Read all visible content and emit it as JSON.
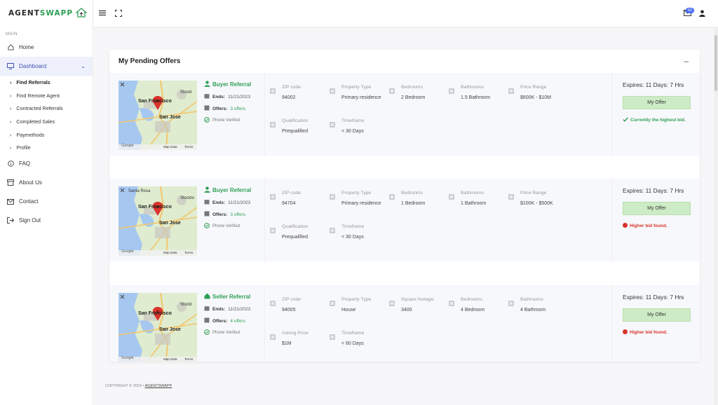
{
  "brand": {
    "logo_text_part1": "AGENT",
    "logo_text_part2": "SWAPP",
    "brand_color": "#2e9f55"
  },
  "sidebar": {
    "section_label": "MAIN",
    "home": "Home",
    "dashboard": "Dashboard",
    "sub_items": [
      {
        "label": "Find Referrals"
      },
      {
        "label": "Find Remote Agent"
      },
      {
        "label": "Contracted Referrals"
      },
      {
        "label": "Completed Sales"
      },
      {
        "label": "Paymethods"
      },
      {
        "label": "Profile"
      }
    ],
    "faq": "FAQ",
    "about": "About Us",
    "contact": "Contact",
    "signout": "Sign Out"
  },
  "topbar": {
    "mail_badge": "62"
  },
  "main": {
    "title": "My Pending Offers",
    "collapse_symbol": "–",
    "offers": [
      {
        "map_labels": {
          "city1": "San Francisco",
          "city2": "San Jose",
          "city3": "Stockt",
          "extra": ""
        },
        "ref_title": "Buyer Referral",
        "ends_label": "Ends:",
        "ends_value": "11/21/2023",
        "offers_label": "Offers:",
        "offers_value": "3 offers",
        "phone": "Phone Verified",
        "fields": [
          {
            "label": "ZIP code",
            "value": "94002"
          },
          {
            "label": "Property Type",
            "value": "Primary residence"
          },
          {
            "label": "Bedrooms",
            "value": "2 Bedroom"
          },
          {
            "label": "Bathrooms",
            "value": "1.5 Bathroom"
          },
          {
            "label": "Price Range",
            "value": "$600K - $10M"
          },
          {
            "label": "Qualification",
            "value": "Prequalified"
          },
          {
            "label": "Timeframe",
            "value": "< 30 Days"
          }
        ],
        "expires": "Expires: 11 Days: 7 Hrs",
        "button": "My Offer",
        "status": "Currently the highest bid."
      },
      {
        "map_labels": {
          "city1": "San Francisco",
          "city2": "San Jose",
          "city3": "Stockto",
          "extra": "Santa Rosa"
        },
        "ref_title": "Buyer Referral",
        "ends_label": "Ends:",
        "ends_value": "11/21/2023",
        "offers_label": "Offers:",
        "offers_value": "3 offers",
        "phone": "Phone Verified",
        "fields": [
          {
            "label": "ZIP code",
            "value": "94704"
          },
          {
            "label": "Property Type",
            "value": "Primary residence"
          },
          {
            "label": "Bedrooms",
            "value": "1 Bedroom"
          },
          {
            "label": "Bathrooms",
            "value": "1 Bathroom"
          },
          {
            "label": "Price Range",
            "value": "$100K - $500K"
          },
          {
            "label": "Qualification",
            "value": "Prequalified"
          },
          {
            "label": "Timeframe",
            "value": "< 30 Days"
          }
        ],
        "expires": "Expires: 11 Days: 7 Hrs",
        "button": "My Offer",
        "status": "Higher bid found."
      },
      {
        "map_labels": {
          "city1": "San Francisco",
          "city2": "San Jose",
          "city3": "Stockt",
          "extra": ""
        },
        "ref_title": "Seller Referral",
        "ends_label": "Ends:",
        "ends_value": "11/21/2023",
        "offers_label": "Offers:",
        "offers_value": "4 offers",
        "phone": "Phone Verified",
        "fields": [
          {
            "label": "ZIP code",
            "value": "94005"
          },
          {
            "label": "Property Type",
            "value": "House"
          },
          {
            "label": "Square footage",
            "value": "3400"
          },
          {
            "label": "Bedrooms",
            "value": "4 Bedroom"
          },
          {
            "label": "Bathrooms",
            "value": "4 Bathroom"
          },
          {
            "label": "Asking Price",
            "value": "$1M"
          },
          {
            "label": "Timeframe",
            "value": "< 60 Days"
          }
        ],
        "expires": "Expires: 11 Days: 7 Hrs",
        "button": "My Offer",
        "status": "Higher bid found."
      }
    ]
  },
  "map_footer": {
    "google": "Google",
    "mapdata": "Map Data",
    "terms": "Terms"
  },
  "footer": {
    "copyright": "COPYRIGHT © 2023 •",
    "link": "AGENTSWAPP"
  }
}
